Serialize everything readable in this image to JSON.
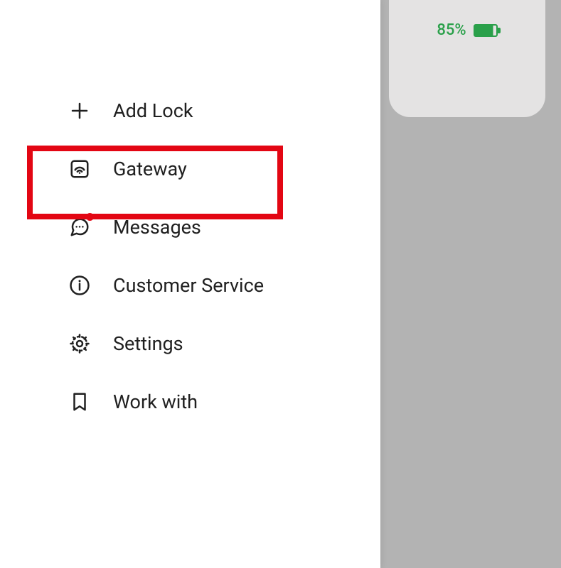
{
  "status": {
    "battery_text": "85%",
    "battery_level": 85
  },
  "menu": {
    "items": [
      {
        "label": "Add Lock"
      },
      {
        "label": "Gateway"
      },
      {
        "label": "Messages"
      },
      {
        "label": "Customer Service"
      },
      {
        "label": "Settings"
      },
      {
        "label": "Work with"
      }
    ]
  },
  "highlight": {
    "target_index": 1,
    "color": "#e30613"
  }
}
